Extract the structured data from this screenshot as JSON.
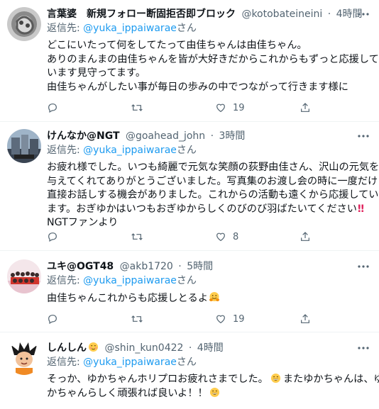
{
  "replying_label": "返信先: ",
  "tweets": [
    {
      "name": "言葉婆　新規フォロー断固拒否即ブロック",
      "handle": "@kotobateineini",
      "time": "4時間",
      "reply_to": "@yuka_ippaiwarae",
      "reply_suffix": "さん",
      "lines": [
        "どこにいたって何をしてたって由佳ちゃんは由佳ちゃん。",
        "ありのまんまの由佳ちゃんを皆が大好きだからこれからもずっと応援して",
        "います見守ってます。",
        "由佳ちゃんがしたい事が毎日の歩みの中でつながって行きます様に"
      ],
      "reply_count": "",
      "retweet_count": "",
      "like_count": "19"
    },
    {
      "name": "けんなか@NGT",
      "handle": "@goahead_john",
      "time": "3時間",
      "reply_to": "@yuka_ippaiwarae",
      "reply_suffix": "さん",
      "lines": [
        "お疲れ様でした。いつも綺麗で元気な笑顔の荻野由佳さん、沢山の元気を",
        "与えてくれてありがとうございました。写真集のお渡し会の時に一度だけ",
        "直接お話しする機会がありました。これからの活動も遠くから応援してい",
        "ます。おぎゆかはいつもおぎゆからしくのびのび羽ばたいてください",
        "NGTファンより"
      ],
      "bang": "!!",
      "reply_count": "",
      "retweet_count": "",
      "like_count": "8"
    },
    {
      "name": "ユキ@OGT48",
      "handle": "@akb1720",
      "time": "5時間",
      "reply_to": "@yuka_ippaiwarae",
      "reply_suffix": "さん",
      "lines": [
        "由佳ちゃんこれからも応援しとるよ"
      ],
      "emoji": "hugging-face",
      "reply_count": "",
      "retweet_count": "",
      "like_count": "19"
    },
    {
      "name": "しんしん",
      "name_emoji": "smiling-face",
      "handle": "@shin_kun0422",
      "time": "4時間",
      "reply_to": "@yuka_ippaiwarae",
      "reply_suffix": "さん",
      "lines": [
        "そっか、ゆかちゃんホリプロお疲れさまでした。",
        "またゆかちゃんは、ゆ",
        "かちゃんらしく頑張れば良いよ！！"
      ],
      "emojis": [
        "grinning-face",
        "grinning-face"
      ],
      "reply_count": "",
      "retweet_count": "",
      "like_count": ""
    }
  ],
  "colors": {
    "text": "#0f1419",
    "secondary": "#536471",
    "link": "#1d9bf0",
    "divider": "#eff3f4"
  }
}
